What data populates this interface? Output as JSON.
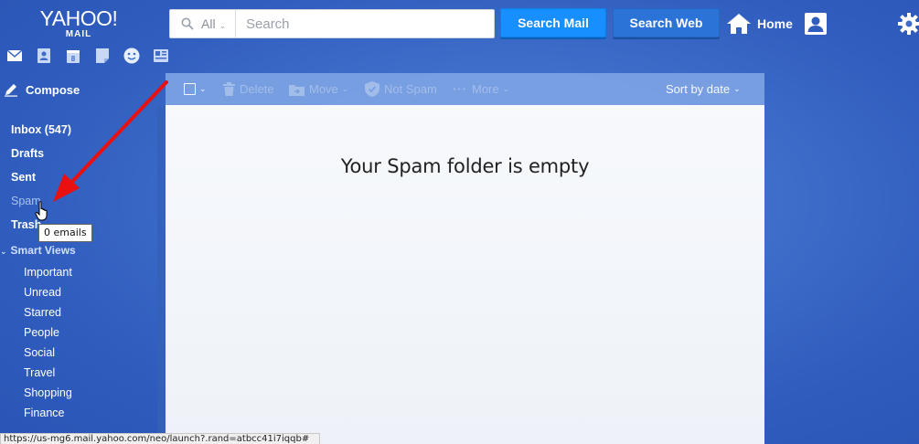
{
  "header": {
    "logo_line1": "YAHOO!",
    "logo_line2": "MAIL",
    "search_scope": "All",
    "search_placeholder": "Search",
    "search_mail_label": "Search Mail",
    "search_web_label": "Search Web",
    "home_label": "Home"
  },
  "apps": [
    "mail-icon",
    "contacts-icon",
    "calendar-icon",
    "notepad-icon",
    "messenger-icon",
    "newsfeed-icon"
  ],
  "sidebar": {
    "compose_label": "Compose",
    "folders": [
      {
        "label": "Inbox (547)"
      },
      {
        "label": "Drafts"
      },
      {
        "label": "Sent"
      },
      {
        "label": "Spam"
      },
      {
        "label": "Trash"
      }
    ],
    "smart_views_label": "Smart Views",
    "smart_views": [
      "Important",
      "Unread",
      "Starred",
      "People",
      "Social",
      "Travel",
      "Shopping",
      "Finance"
    ]
  },
  "tooltip": "0 emails",
  "statusbar_url": "https://us-mg6.mail.yahoo.com/neo/launch?.rand=atbcc41i7iqqb#",
  "toolbar": {
    "delete_label": "Delete",
    "move_label": "Move",
    "not_spam_label": "Not Spam",
    "more_label": "More",
    "sort_label": "Sort by date"
  },
  "main": {
    "empty_message": "Your Spam folder is empty"
  },
  "colors": {
    "primary_button": "#188fff",
    "secondary_button": "#2b73d6",
    "annotation_arrow": "#e81010"
  }
}
